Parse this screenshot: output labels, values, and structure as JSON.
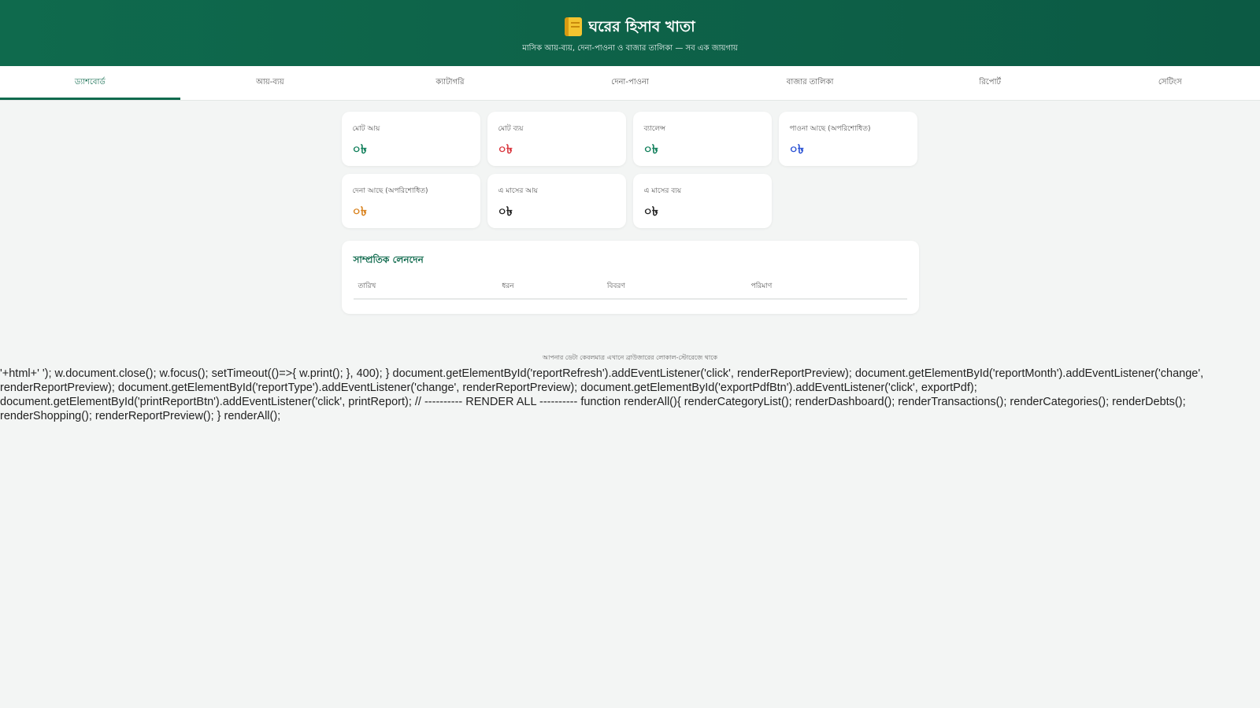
{
  "header": {
    "icon": "notebook-icon",
    "title": "ঘরের হিসাব খাতা",
    "subtitle": "মাসিক আয়-ব্যয়, দেনা-পাওনা ও বাজার তালিকা — সব এক জায়গায়"
  },
  "tabs": [
    {
      "label": "ড্যাশবোর্ড",
      "active": true
    },
    {
      "label": "আয়-ব্যয়"
    },
    {
      "label": "ক্যাটাগরি"
    },
    {
      "label": "দেনা-পাওনা"
    },
    {
      "label": "বাজার তালিকা"
    },
    {
      "label": "রিপোর্ট"
    },
    {
      "label": "সেটিংস"
    }
  ],
  "cards": [
    {
      "label": "মোট আয়",
      "value": "০৳",
      "color": "#12805c"
    },
    {
      "label": "মোট ব্যয়",
      "value": "০৳",
      "color": "#d9363e"
    },
    {
      "label": "ব্যালেন্স",
      "value": "০৳",
      "color": "#12805c"
    },
    {
      "label": "পাওনা আছে (অপরিশোধিত)",
      "value": "০৳",
      "color": "#2a52d4"
    },
    {
      "label": "দেনা আছে (অপরিশোধিত)",
      "value": "০৳",
      "color": "#d9831f"
    },
    {
      "label": "এ মাসের আয়",
      "value": "০৳",
      "color": "#222222"
    },
    {
      "label": "এ মাসের ব্যয়",
      "value": "০৳",
      "color": "#222222"
    }
  ],
  "panel": {
    "title": "সাম্প্রতিক লেনদেন",
    "columns": [
      "তারিখ",
      "ধরন",
      "বিবরণ",
      "পরিমাণ"
    ]
  },
  "footer_note": "আপনার ডেটা কেবলমাত্র এখানে ব্রাউজারের লোকাল-স্টোরেজে থাকে",
  "raw_code": "'+html+' '); w.document.close(); w.focus(); setTimeout(()=>{ w.print(); }, 400); } document.getElementById('reportRefresh').addEventListener('click', renderReportPreview); document.getElementById('reportMonth').addEventListener('change', renderReportPreview); document.getElementById('reportType').addEventListener('change', renderReportPreview); document.getElementById('exportPdfBtn').addEventListener('click', exportPdf); document.getElementById('printReportBtn').addEventListener('click', printReport); // ---------- RENDER ALL ---------- function renderAll(){ renderCategoryList(); renderDashboard(); renderTransactions(); renderCategories(); renderDebts(); renderShopping(); renderReportPreview(); } renderAll();",
  "colors": {
    "brand": "#0f6a4d",
    "background": "#f3f5f4"
  }
}
